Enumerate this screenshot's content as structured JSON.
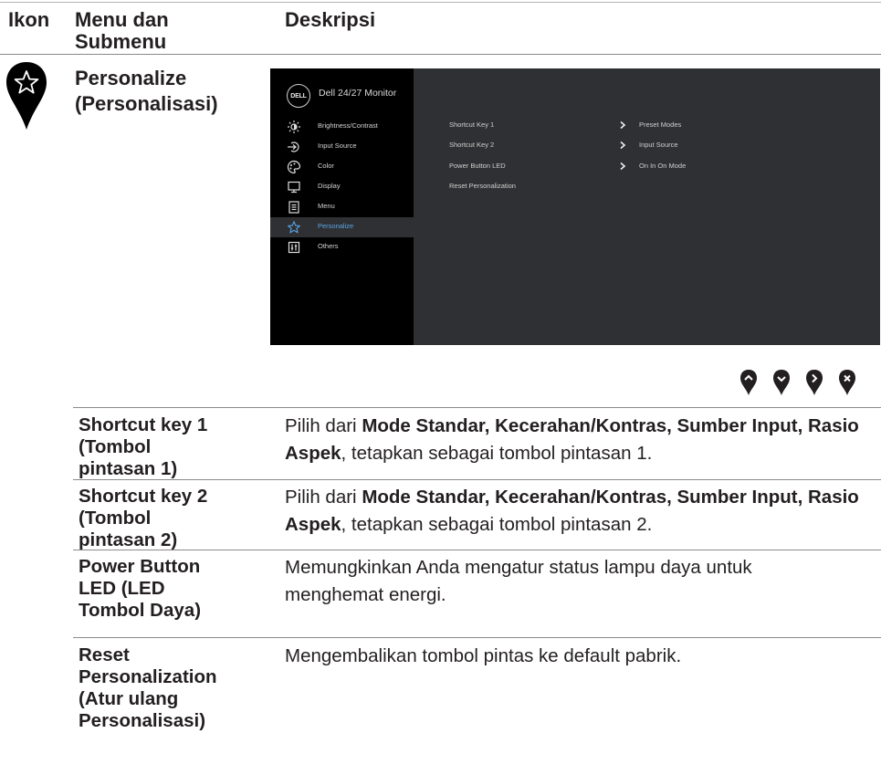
{
  "header": {
    "col_icon": "Ikon",
    "col_menu_line1": "Menu dan",
    "col_menu_line2": "Submenu",
    "col_desc": "Deskripsi"
  },
  "section": {
    "icon": "star-pin-icon",
    "title_line1": "Personalize",
    "title_line2": "(Personalisasi)"
  },
  "osd": {
    "logo": "DELL",
    "title": "Dell 24/27 Monitor",
    "menu": [
      {
        "label": "Brightness/Contrast",
        "icon": "sun-icon"
      },
      {
        "label": "Input Source",
        "icon": "input-arrow-icon"
      },
      {
        "label": "Color",
        "icon": "palette-icon"
      },
      {
        "label": "Display",
        "icon": "display-icon"
      },
      {
        "label": "Menu",
        "icon": "menu-icon"
      },
      {
        "label": "Personalize",
        "icon": "star-icon",
        "active": true
      },
      {
        "label": "Others",
        "icon": "others-icon"
      }
    ],
    "rows": [
      {
        "label": "Shortcut Key 1",
        "value": "Preset Modes"
      },
      {
        "label": "Shortcut Key 2",
        "value": "Input Source"
      },
      {
        "label": "Power Button LED",
        "value": "On In On Mode"
      },
      {
        "label": "Reset Personalization",
        "value": ""
      }
    ]
  },
  "nav_buttons": [
    "up-icon",
    "down-icon",
    "right-icon",
    "close-icon"
  ],
  "table": [
    {
      "label_lines": [
        "Shortcut key 1",
        "(Tombol",
        "pintasan 1)"
      ],
      "desc_prefix": "Pilih dari ",
      "desc_bold": "Mode Standar, Kecerahan/Kontras, Sumber Input, Rasio Aspek",
      "desc_suffix": ", tetapkan sebagai tombol pintasan 1."
    },
    {
      "label_lines": [
        "Shortcut key 2",
        "(Tombol",
        "pintasan 2)"
      ],
      "desc_prefix": "Pilih dari ",
      "desc_bold": "Mode Standar, Kecerahan/Kontras, Sumber Input, Rasio Aspek",
      "desc_suffix": ", tetapkan sebagai tombol pintasan 2."
    },
    {
      "label_lines": [
        "Power Button",
        "LED (LED",
        "Tombol Daya)"
      ],
      "desc_prefix": "Memungkinkan Anda mengatur status lampu daya untuk menghemat energi.",
      "desc_bold": "",
      "desc_suffix": ""
    },
    {
      "label_lines": [
        "Reset",
        "Personalization",
        "(Atur ulang",
        "Personalisasi)"
      ],
      "desc_prefix": "Mengembalikan tombol pintas ke default pabrik.",
      "desc_bold": "",
      "desc_suffix": ""
    }
  ]
}
